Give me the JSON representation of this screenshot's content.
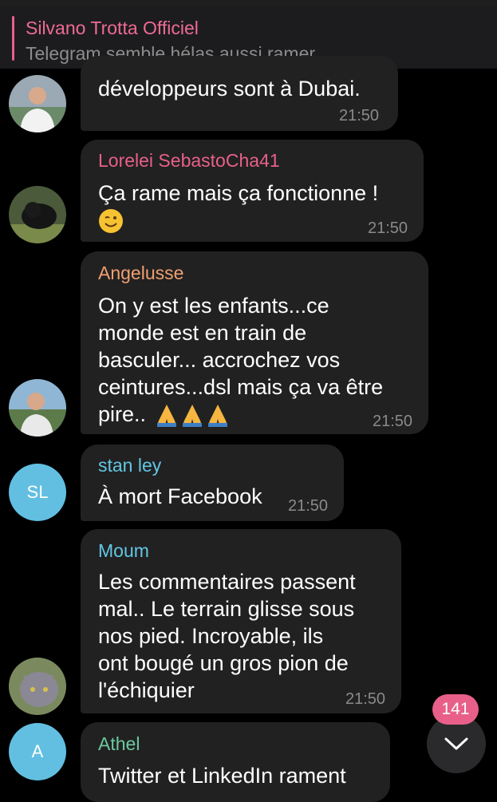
{
  "pinned": {
    "title": "Silvano Trotta Officiel",
    "subtitle": "Telegram semble hélas aussi ramer"
  },
  "messages": [
    {
      "sender": "",
      "text": "développeurs sont à Dubai.",
      "time": "21:50",
      "avatar": "man-white-shirt-photo"
    },
    {
      "sender": "Lorelei SebastoCha41",
      "text": "Ça rame mais ça fonctionne !",
      "emoji": "winking-face",
      "time": "21:50",
      "avatar": "black-panther-photo"
    },
    {
      "sender": "Angelusse",
      "lines": [
        "On y est les enfants...ce",
        "monde est en train de",
        "basculer... accrochez vos",
        "ceintures...dsl mais ça va être",
        "pire.."
      ],
      "emoji": "folded-hands x3",
      "time": "21:50",
      "avatar": "man-outdoor-photo"
    },
    {
      "sender": "stan ley",
      "text": "À mort Facebook",
      "time": "21:50",
      "avatar_initials": "SL"
    },
    {
      "sender": "Moum",
      "lines": [
        "Les commentaires passent",
        "mal.. Le terrain glisse sous",
        "nos pied. Incroyable, ils",
        "ont bougé un gros pion de",
        "l'échiquier"
      ],
      "time": "21:50",
      "avatar": "grey-cat-photo"
    },
    {
      "sender": "Athel",
      "text": "Twitter et LinkedIn rament",
      "avatar_initials": "A"
    }
  ],
  "scroll": {
    "unread_count": "141",
    "icon": "chevron-down-icon"
  },
  "colors": {
    "background": "#000000",
    "bubble": "#212121",
    "pinned_accent": "#e8608a",
    "name_lorelei": "#e8608a",
    "name_angelusse": "#f0a070",
    "name_stanley": "#62c6e4",
    "name_moum": "#62c6e4",
    "name_athel": "#6cc8a0",
    "avatar_initials_bg": "#62bfe1"
  }
}
